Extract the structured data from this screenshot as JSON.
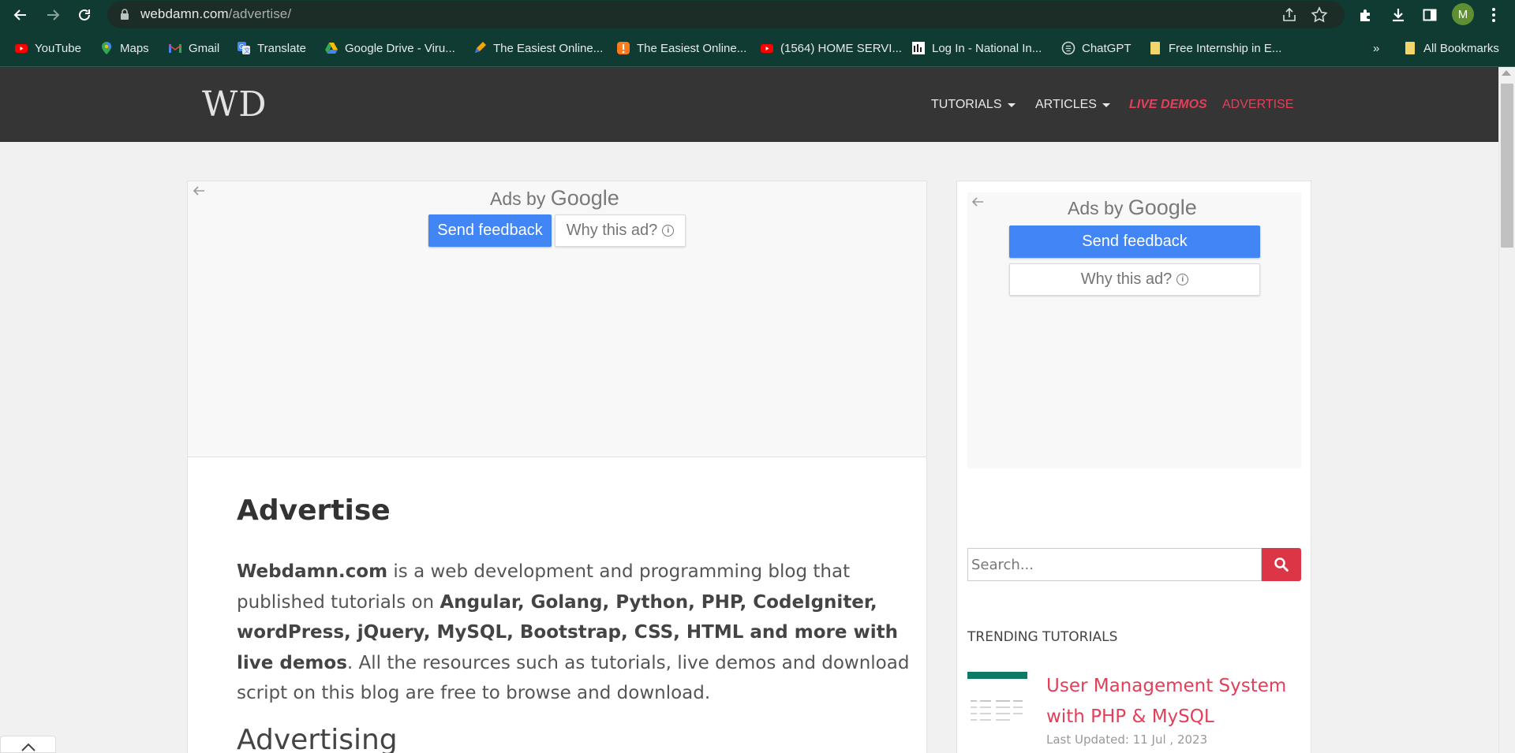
{
  "browser": {
    "url_host": "webdamn.com",
    "url_path": "/advertise/",
    "profile_initial": "M",
    "bookmarks": [
      {
        "label": "YouTube",
        "icon": "youtube-icon",
        "color": "#ff0000"
      },
      {
        "label": "Maps",
        "icon": "maps-icon",
        "color": "#34a853"
      },
      {
        "label": "Gmail",
        "icon": "gmail-icon",
        "color": "#ea4335"
      },
      {
        "label": "Translate",
        "icon": "translate-icon",
        "color": "#4285f4"
      },
      {
        "label": "Google Drive - Viru...",
        "icon": "drive-icon",
        "color": "#fbbc04"
      },
      {
        "label": "The Easiest Online...",
        "icon": "pen-icon",
        "color": "#f4a300"
      },
      {
        "label": "The Easiest Online...",
        "icon": "app-icon",
        "color": "#ff7a1a"
      },
      {
        "label": "(1564) HOME SERVI...",
        "icon": "youtube-icon",
        "color": "#ff0000"
      },
      {
        "label": "Log In - National In...",
        "icon": "ni-icon",
        "color": "#ffffff"
      },
      {
        "label": "ChatGPT",
        "icon": "chatgpt-icon",
        "color": "#cfd8d4"
      },
      {
        "label": "Free Internship in E...",
        "icon": "folder-icon",
        "color": "#f2d66b"
      }
    ],
    "all_bookmarks": "All Bookmarks",
    "overflow": "»"
  },
  "site": {
    "logo": "WD",
    "menu": [
      {
        "label": "TUTORIALS",
        "dropdown": true
      },
      {
        "label": "ARTICLES",
        "dropdown": true
      },
      {
        "label": "LIVE DEMOS",
        "dropdown": false
      },
      {
        "label": "ADVERTISE",
        "dropdown": false
      }
    ]
  },
  "ads": {
    "ads_by": "Ads by",
    "google": "Google",
    "send_feedback": "Send feedback",
    "why_this_ad": "Why this ad?"
  },
  "article": {
    "title": "Advertise",
    "intro_brand": "Webdamn.com",
    "intro_part1": " is a web development and programming blog that published tutorials on ",
    "intro_topics": "Angular, Golang, Python, PHP, CodeIgniter, wordPress, jQuery, MySQL, Bootstrap, CSS, HTML and more with live demos",
    "intro_part2": ". All the resources such as tutorials, live demos and download script on this blog are free to browse and download.",
    "subheading": "Advertising"
  },
  "sidebar": {
    "search_placeholder": "Search...",
    "trending_heading": "TRENDING TUTORIALS",
    "tutorials": [
      {
        "title": "User Management System with PHP & MySQL",
        "date": "Last Updated: 11 Jul , 2023"
      }
    ]
  },
  "colors": {
    "chrome": "#0f3b33",
    "site_header": "#353535",
    "accent_red": "#e2405a",
    "ad_blue": "#4285f4",
    "search_red": "#dc3545"
  }
}
